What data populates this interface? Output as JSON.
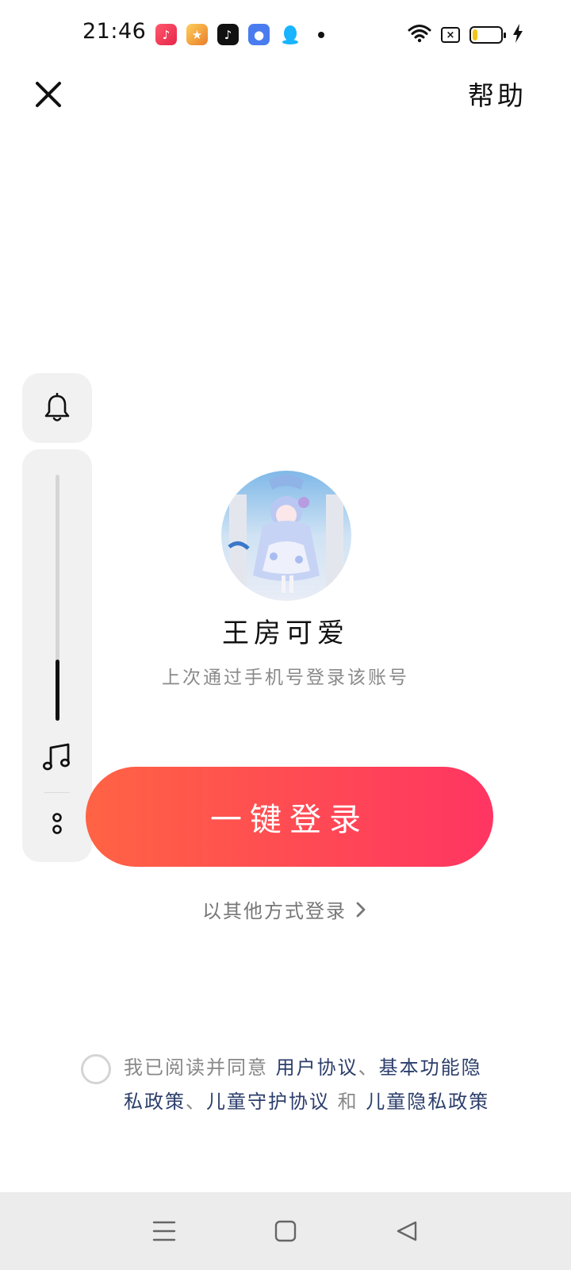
{
  "status_bar": {
    "time": "21:46",
    "app_icons": [
      "music-app-icon",
      "game-app-icon",
      "tiktok-app-icon",
      "chat-app-icon",
      "qq-app-icon"
    ],
    "battery_level": 0.25,
    "sim_status": "×"
  },
  "header": {
    "close_icon": "close-icon",
    "help_label": "帮助"
  },
  "side_panel": {
    "bell_icon": "bell-icon",
    "volume_level": 0.25,
    "music_icon": "music-note-icon",
    "more_icon": "more-dots-icon"
  },
  "profile": {
    "username": "王房可爱",
    "subtitle": "上次通过手机号登录该账号"
  },
  "actions": {
    "one_click_login": "一键登录",
    "other_login": "以其他方式登录"
  },
  "agreement": {
    "prefix": "我已阅读并同意 ",
    "link_user": "用户协议",
    "sep1": "、",
    "link_basic": "基本功能隐私政策",
    "sep2": "、",
    "link_child": "儿童守护协议",
    "and": " 和 ",
    "link_child_privacy": "儿童隐私政策"
  },
  "nav_bar": {
    "menu_icon": "menu-icon",
    "home_icon": "home-icon",
    "back_icon": "back-icon"
  },
  "colors": {
    "login_gradient_start": "#ff6344",
    "login_gradient_end": "#ff3562",
    "agreement_link": "#2c3e6b"
  }
}
